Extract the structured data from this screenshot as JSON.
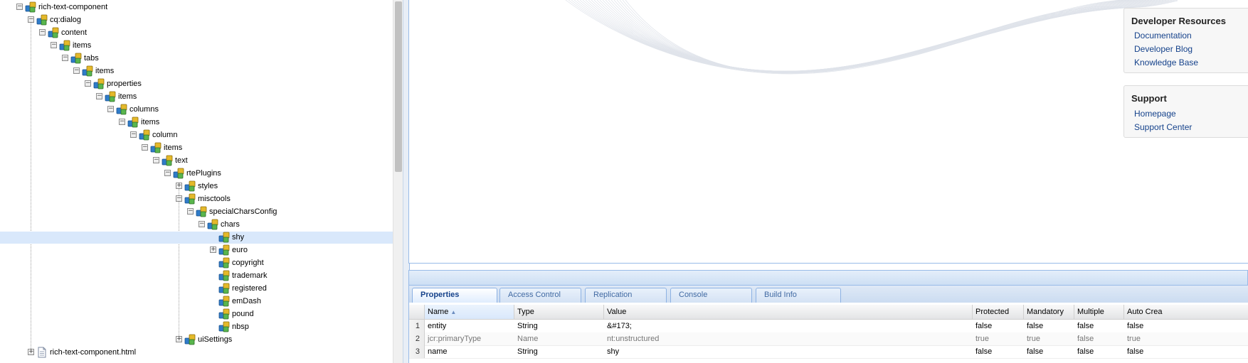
{
  "tree": {
    "nodes": [
      {
        "label": "rich-text-component",
        "toggle": "minus",
        "type": "node"
      },
      {
        "label": "cq:dialog",
        "toggle": "minus",
        "type": "node"
      },
      {
        "label": "content",
        "toggle": "minus",
        "type": "node"
      },
      {
        "label": "items",
        "toggle": "minus",
        "type": "node"
      },
      {
        "label": "tabs",
        "toggle": "minus",
        "type": "node"
      },
      {
        "label": "items",
        "toggle": "minus",
        "type": "node"
      },
      {
        "label": "properties",
        "toggle": "minus",
        "type": "node"
      },
      {
        "label": "items",
        "toggle": "minus",
        "type": "node"
      },
      {
        "label": "columns",
        "toggle": "minus",
        "type": "node"
      },
      {
        "label": "items",
        "toggle": "minus",
        "type": "node"
      },
      {
        "label": "column",
        "toggle": "minus",
        "type": "node"
      },
      {
        "label": "items",
        "toggle": "minus",
        "type": "node"
      },
      {
        "label": "text",
        "toggle": "minus",
        "type": "node"
      },
      {
        "label": "rtePlugins",
        "toggle": "minus",
        "type": "node"
      },
      {
        "label": "styles",
        "toggle": "plus",
        "type": "node"
      },
      {
        "label": "misctools",
        "toggle": "minus",
        "type": "node"
      },
      {
        "label": "specialCharsConfig",
        "toggle": "minus",
        "type": "node"
      },
      {
        "label": "chars",
        "toggle": "minus",
        "type": "node"
      },
      {
        "label": "shy",
        "toggle": "none",
        "type": "node",
        "selected": true
      },
      {
        "label": "euro",
        "toggle": "plus",
        "type": "node"
      },
      {
        "label": "copyright",
        "toggle": "none",
        "type": "node"
      },
      {
        "label": "trademark",
        "toggle": "none",
        "type": "node"
      },
      {
        "label": "registered",
        "toggle": "none",
        "type": "node"
      },
      {
        "label": "emDash",
        "toggle": "none",
        "type": "node"
      },
      {
        "label": "pound",
        "toggle": "none",
        "type": "node"
      },
      {
        "label": "nbsp",
        "toggle": "none",
        "type": "node"
      },
      {
        "label": "uiSettings",
        "toggle": "plus",
        "type": "node"
      },
      {
        "label": "rich-text-component.html",
        "toggle": "plus",
        "type": "file"
      }
    ]
  },
  "sidebar": {
    "developer": {
      "title": "Developer Resources",
      "links": [
        "Documentation",
        "Developer Blog",
        "Knowledge Base"
      ]
    },
    "support": {
      "title": "Support",
      "links": [
        "Homepage",
        "Support Center"
      ]
    }
  },
  "tabs": [
    "Properties",
    "Access Control",
    "Replication",
    "Console",
    "Build Info"
  ],
  "active_tab": "Properties",
  "grid": {
    "headers": [
      "Name",
      "Type",
      "Value",
      "Protected",
      "Mandatory",
      "Multiple",
      "Auto Crea"
    ],
    "sorted_column": "Name",
    "rows": [
      {
        "num": "1",
        "cells": [
          "entity",
          "String",
          "&#173;",
          "false",
          "false",
          "false",
          "false"
        ],
        "dim": false
      },
      {
        "num": "2",
        "cells": [
          "jcr:primaryType",
          "Name",
          "nt:unstructured",
          "true",
          "true",
          "false",
          "true"
        ],
        "dim": true
      },
      {
        "num": "3",
        "cells": [
          "name",
          "String",
          "shy",
          "false",
          "false",
          "false",
          "false"
        ],
        "dim": false
      }
    ]
  },
  "colors": {
    "accent": "#15428b",
    "selected_row": "#d9e8fb",
    "border": "#99bbe8"
  },
  "icons": {
    "node": "node-icon",
    "file": "file-icon",
    "expand": "expand-plus-icon",
    "collapse": "collapse-minus-icon"
  }
}
